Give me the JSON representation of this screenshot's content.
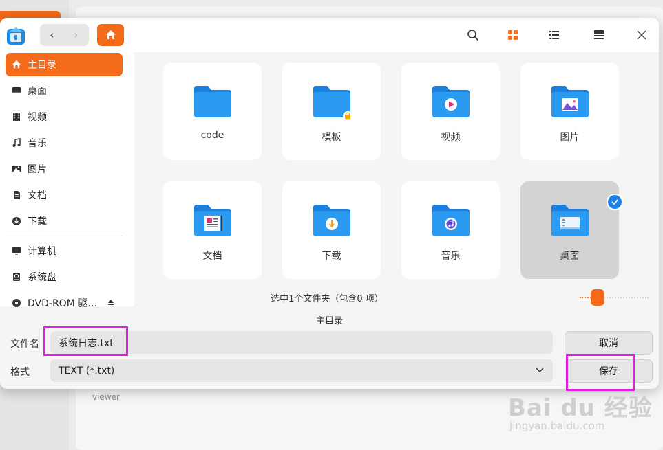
{
  "background": {
    "text": "viewer"
  },
  "toolbar": {
    "back_glyph": "‹",
    "forward_glyph": "›",
    "icons": [
      "search-icon",
      "icon-view-icon",
      "list-view-icon",
      "tree-view-icon",
      "close-icon"
    ]
  },
  "sidebar": {
    "items": [
      {
        "label": "主目录",
        "icon": "home-icon",
        "active": true
      },
      {
        "label": "桌面",
        "icon": "desktop-icon"
      },
      {
        "label": "视频",
        "icon": "video-icon"
      },
      {
        "label": "音乐",
        "icon": "music-icon"
      },
      {
        "label": "图片",
        "icon": "picture-icon"
      },
      {
        "label": "文档",
        "icon": "document-icon"
      },
      {
        "label": "下载",
        "icon": "download-icon"
      },
      {
        "label": "计算机",
        "icon": "computer-icon"
      },
      {
        "label": "系统盘",
        "icon": "disk-icon"
      },
      {
        "label": "DVD-ROM 驱…",
        "icon": "dvd-icon"
      }
    ]
  },
  "folders": [
    {
      "label": "code",
      "badge": "none"
    },
    {
      "label": "模板",
      "badge": "lock"
    },
    {
      "label": "视频",
      "badge": "video"
    },
    {
      "label": "图片",
      "badge": "picture"
    },
    {
      "label": "文档",
      "badge": "document"
    },
    {
      "label": "下载",
      "badge": "download"
    },
    {
      "label": "音乐",
      "badge": "music"
    },
    {
      "label": "桌面",
      "badge": "desktop",
      "selected": true
    }
  ],
  "status": {
    "text": "选中1个文件夹（包含0 项）",
    "zoom_level": 0.2
  },
  "form": {
    "location": "主目录",
    "filename_label": "文件名",
    "filename_value": "系统日志.txt",
    "format_label": "格式",
    "format_value": "TEXT (*.txt)",
    "cancel_label": "取消",
    "save_label": "保存"
  },
  "watermark": {
    "main": "Bai du 经验",
    "sub": "jingyan.baidu.com"
  },
  "colors": {
    "accent": "#f36a1a",
    "folder": "#1a8ce8",
    "highlight": "#e21ee0",
    "check": "#1a7fe6"
  }
}
